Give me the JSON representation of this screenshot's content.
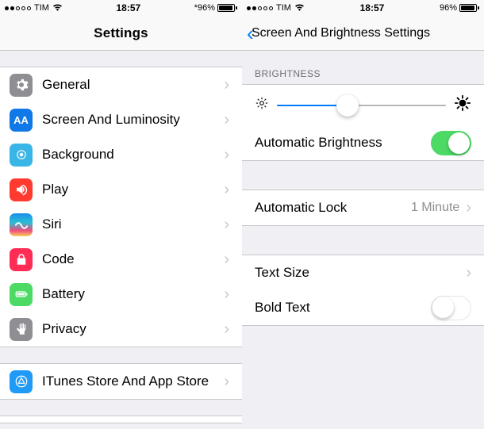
{
  "left": {
    "status": {
      "carrier": "TIM",
      "time": "18:57",
      "battery_pct": "96%"
    },
    "nav_title": "Settings",
    "rows": [
      {
        "key": "general",
        "label": "General"
      },
      {
        "key": "display",
        "label": "Screen And Luminosity"
      },
      {
        "key": "wallpaper",
        "label": "Background"
      },
      {
        "key": "sounds",
        "label": "Play"
      },
      {
        "key": "siri",
        "label": "Siri"
      },
      {
        "key": "code",
        "label": "Code"
      },
      {
        "key": "battery",
        "label": "Battery"
      },
      {
        "key": "privacy",
        "label": "Privacy"
      }
    ],
    "itunes_label": "ITunes Store And App Store"
  },
  "right": {
    "status": {
      "carrier": "TIM",
      "time": "18:57",
      "battery_pct": "96%"
    },
    "back_title": "Screen And Brightness Settings",
    "section_brightness": "BRIGHTNESS",
    "brightness_value_pct": 42,
    "auto_brightness_label": "Automatic Brightness",
    "auto_brightness_on": true,
    "auto_lock_label": "Automatic Lock",
    "auto_lock_value": "1 Minute",
    "text_size_label": "Text Size",
    "bold_text_label": "Bold Text",
    "bold_text_on": false
  }
}
